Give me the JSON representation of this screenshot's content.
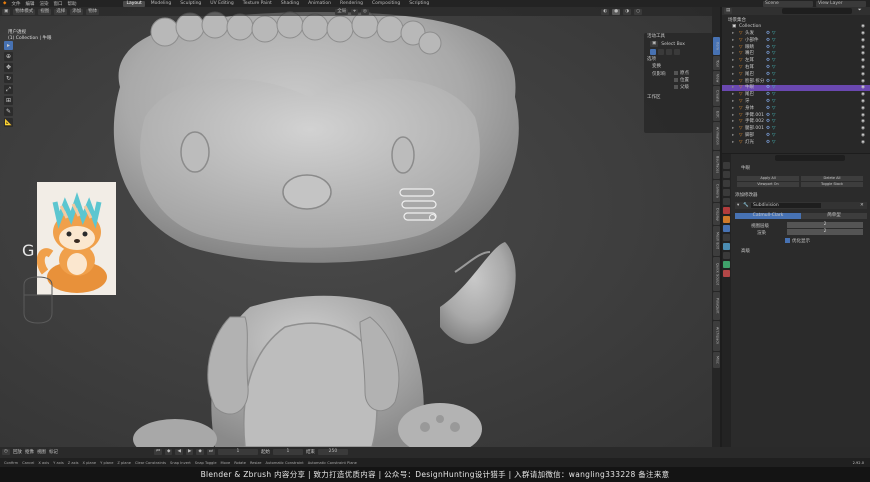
{
  "topbar": {
    "menus": [
      "文件",
      "编辑",
      "渲染",
      "窗口",
      "帮助"
    ],
    "workspaces": [
      "Layout",
      "Modeling",
      "Sculpting",
      "UV Editing",
      "Texture Paint",
      "Shading",
      "Animation",
      "Rendering",
      "Compositing",
      "Scripting"
    ],
    "active_workspace": "Layout",
    "scene_label": "Scene",
    "view_layer_label": "View Layer"
  },
  "viewport": {
    "header_mode": "物体模式",
    "header_menus": [
      "视图",
      "选择",
      "添加",
      "物体"
    ],
    "orientation": "全局",
    "overlay_text_1": "用户透视",
    "overlay_text_2": "(1) Collection | 牛眼",
    "key_hint": "G",
    "gizmo_axis_labels": [
      "X",
      "Y",
      "Z"
    ]
  },
  "npanel": {
    "tool_title": "活动工具",
    "select_box": "Select Box",
    "options_title": "选项",
    "transform_title": "变换",
    "affect_label": "仅影响",
    "opt_origins": "原点",
    "opt_locations": "位置",
    "opt_parents": "父级",
    "workspace_title": "工作区"
  },
  "sidebar_tabs": [
    "Item",
    "Tool",
    "View",
    "Create",
    "Edit",
    "Animation",
    "Bsurfaces",
    "Camera",
    "Display",
    "Mesh Edit",
    "Quick Sculpt",
    "PolyQuilt",
    "Archipack",
    "Misc"
  ],
  "outliner": {
    "title": "场景集合",
    "collection": "Collection",
    "items": [
      "头发",
      "小部件",
      "眼睛",
      "嘴巴",
      "左耳",
      "右耳",
      "尾巴",
      "脸部.拆分",
      "牛眼",
      "尾巴",
      "牙",
      "身体",
      "手臂.001",
      "手臂.002",
      "腿部.001",
      "脚部",
      "灯光"
    ],
    "selected_index": 8
  },
  "properties": {
    "tab_name": "牛眼",
    "btn_apply": "Apply All",
    "btn_delete": "Delete All",
    "btn_viewport": "Viewport On",
    "btn_toggle": "Toggle Stack",
    "modifier_title": "添加修改器",
    "modifier_name": "Subdivision",
    "mode_catmull": "Catmull-Clark",
    "mode_simple": "简单型",
    "field_levels": "视图层级",
    "field_render": "渲染",
    "levels_value": "2",
    "render_value": "2",
    "opt_optimal": "优化显示",
    "advanced_label": "高级"
  },
  "timeline": {
    "menus": [
      "回放",
      "抠像",
      "视图",
      "标记"
    ],
    "frame_current": "1",
    "frame_start": "1",
    "frame_end": "250",
    "start_label": "起始",
    "end_label": "结束"
  },
  "statusbar": {
    "items": [
      "Confirm",
      "Cancel",
      "X axis",
      "Y axis",
      "Z axis",
      "X plane",
      "Y plane",
      "Z plane",
      "Clear Constraints",
      "Snap Invert",
      "Snap Toggle",
      "Move",
      "Rotate",
      "Resize",
      "Automatic Constraint",
      "Automatic Constraint Plane"
    ],
    "version": "2.92.0"
  },
  "banner": {
    "text": "Blender & Zbrush 内容分享  |  致力打造优质内容  |  公众号：DesignHunting设计猎手  |  入群请加微信：wangling333228 备注来意"
  },
  "colors": {
    "accent": "#4772b3",
    "selection": "#6a48b0",
    "object_orange": "#e0892c",
    "data_cyan": "#46c7c7"
  }
}
